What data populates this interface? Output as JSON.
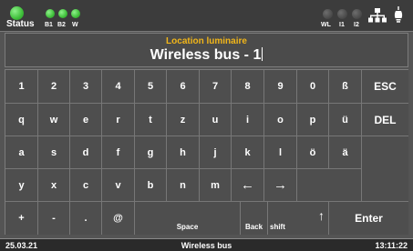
{
  "topbar": {
    "status_label": "Status",
    "led_labels": [
      "B1",
      "B2",
      "W"
    ],
    "right_led_labels": [
      "WL",
      "I1",
      "I2"
    ],
    "icons": [
      "network-icon",
      "bulb-icon"
    ],
    "colors": {
      "led_on": "#3fbf3a",
      "led_off": "#4a4a4a"
    }
  },
  "header": {
    "title": "Location luminaire",
    "input_value": "Wireless bus - 1",
    "title_color": "#f2b619"
  },
  "keyboard": {
    "row1": [
      "1",
      "2",
      "3",
      "4",
      "5",
      "6",
      "7",
      "8",
      "9",
      "0",
      "ß",
      "ESC"
    ],
    "row2": [
      "q",
      "w",
      "e",
      "r",
      "t",
      "z",
      "u",
      "i",
      "o",
      "p",
      "ü",
      "DEL"
    ],
    "row3": [
      "a",
      "s",
      "d",
      "f",
      "g",
      "h",
      "j",
      "k",
      "l",
      "ö",
      "ä"
    ],
    "row4": [
      "y",
      "x",
      "c",
      "v",
      "b",
      "n",
      "m",
      "←",
      "→"
    ],
    "row5": {
      "plus": "+",
      "minus": "-",
      "dot": ".",
      "at": "@",
      "space": "Space",
      "back": "Back",
      "shift": "shift",
      "shift_arrow": "↑",
      "enter": "Enter"
    }
  },
  "footer": {
    "date": "25.03.21",
    "center": "Wireless bus",
    "time": "13:11:22"
  }
}
